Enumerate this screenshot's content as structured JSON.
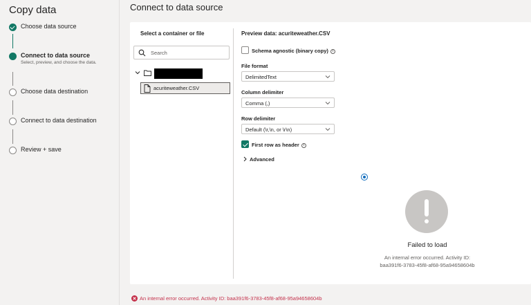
{
  "wizard": {
    "title": "Copy data",
    "steps": [
      {
        "label": "Choose data source",
        "state": "done"
      },
      {
        "label": "Connect to data source",
        "state": "current",
        "subtitle": "Select, preview, and choose the data."
      },
      {
        "label": "Choose data destination",
        "state": "todo"
      },
      {
        "label": "Connect to data destination",
        "state": "todo"
      },
      {
        "label": "Review + save",
        "state": "todo"
      }
    ]
  },
  "main": {
    "title": "Connect to data source",
    "browser": {
      "heading": "Select a container or file",
      "search_placeholder": "Search",
      "file_name": "acuriteweather.CSV"
    },
    "preview": {
      "heading": "Preview data: acuriteweather.CSV",
      "schema_agnostic_label": "Schema agnostic (binary copy)",
      "schema_agnostic_checked": false,
      "file_format_label": "File format",
      "file_format_value": "DelimitedText",
      "column_delimiter_label": "Column delimiter",
      "column_delimiter_value": "Comma (,)",
      "row_delimiter_label": "Row delimiter",
      "row_delimiter_value": "Default (\\r,\\n, or \\r\\n)",
      "first_row_header_label": "First row as header",
      "first_row_header_checked": true,
      "advanced_label": "Advanced",
      "failed_title": "Failed to load",
      "failed_message_line1": "An internal error occurred. Activity ID:",
      "failed_message_line2": "baa391f6-3783-45f8-af68-95a94658604b"
    }
  },
  "footer_error": "An internal error occurred. Activity ID: baa391f6-3783-45f8-af68-95a94658604b",
  "colors": {
    "accent": "#117865",
    "error": "#c4314b",
    "info": "#0f6cbd"
  }
}
